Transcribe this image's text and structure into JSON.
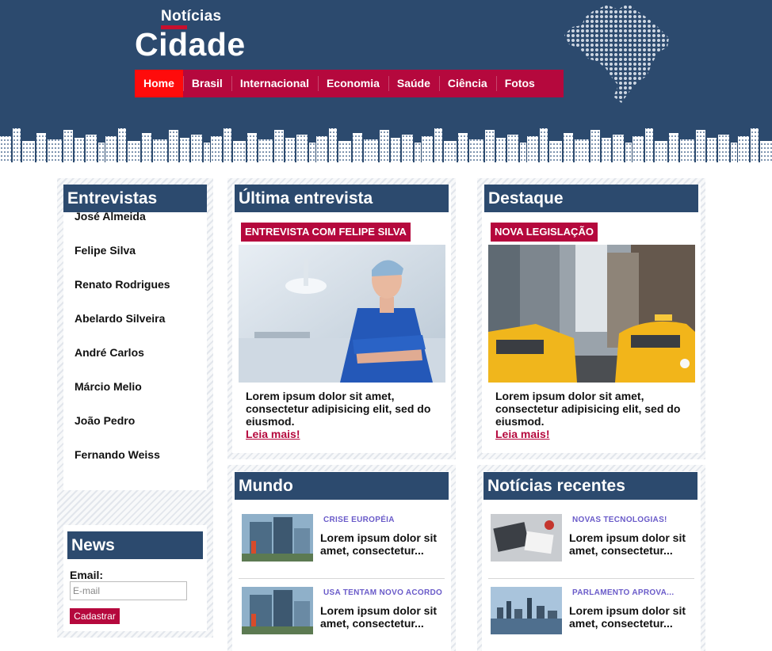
{
  "header": {
    "logo_small": "Notícias",
    "logo_big": "Cidade",
    "nav": [
      {
        "label": "Home",
        "active": true
      },
      {
        "label": "Brasil"
      },
      {
        "label": "Internacional"
      },
      {
        "label": "Economia"
      },
      {
        "label": "Saúde"
      },
      {
        "label": "Ciência"
      },
      {
        "label": "Fotos"
      }
    ]
  },
  "sidebar": {
    "title": "Entrevistas",
    "items": [
      "José Almeida",
      "Felipe Silva",
      "Renato Rodrigues",
      "Abelardo Silveira",
      "André Carlos",
      "Márcio Melio",
      "João Pedro",
      "Fernando Weiss"
    ]
  },
  "newsletter": {
    "title": "News",
    "email_label": "Email:",
    "email_placeholder": "E-mail",
    "button_label": "Cadastrar"
  },
  "ultima_entrevista": {
    "title": "Última entrevista",
    "tag": "ENTREVISTA COM FELIPE SILVA",
    "text": "Lorem ipsum dolor sit amet, consectetur adipisicing elit, sed do eiusmod.",
    "read_more": "Leia mais!"
  },
  "destaque": {
    "title": "Destaque",
    "tag": "NOVA LEGISLAÇÃO",
    "text": "Lorem ipsum dolor sit amet, consectetur adipisicing elit, sed do eiusmod.",
    "read_more": "Leia mais!"
  },
  "mundo": {
    "title": "Mundo",
    "items": [
      {
        "kicker": "CRISE EUROPÉIA",
        "snippet": "Lorem ipsum dolor sit amet, consectetur..."
      },
      {
        "kicker": "USA TENTAM NOVO ACORDO",
        "snippet": "Lorem ipsum dolor sit amet, consectetur..."
      }
    ]
  },
  "recentes": {
    "title": "Notícias recentes",
    "items": [
      {
        "kicker": "NOVAS TECNOLOGIAS!",
        "snippet": "Lorem ipsum dolor sit amet, consectetur..."
      },
      {
        "kicker": "PARLAMENTO APROVA...",
        "snippet": "Lorem ipsum dolor sit amet, consectetur..."
      }
    ]
  },
  "colors": {
    "header_bg": "#2c4a6e",
    "nav_bg": "#b5083d",
    "nav_active": "#ff0b0b",
    "kicker": "#6a5bc9"
  }
}
